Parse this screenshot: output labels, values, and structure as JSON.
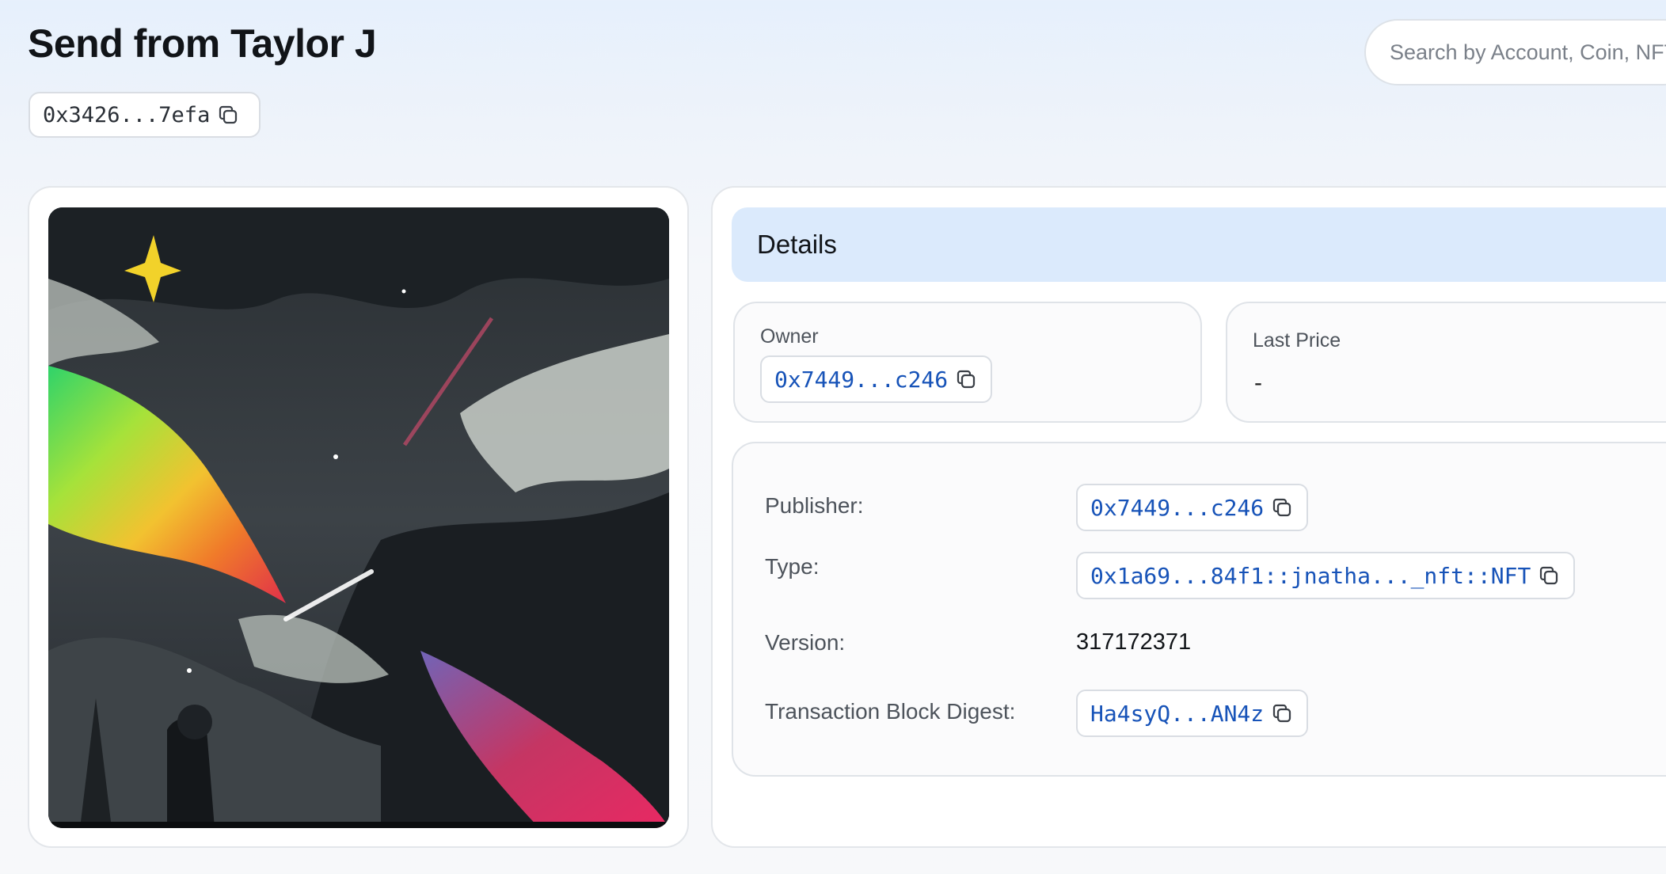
{
  "page": {
    "title": "Send from Taylor J",
    "address_short": "0x3426...7efa"
  },
  "search": {
    "placeholder": "Search by Account, Coin, NFT, Package, Object, Transaction..."
  },
  "details": {
    "header": "Details",
    "owner": {
      "label": "Owner",
      "value": "0x7449...c246"
    },
    "last_price": {
      "label": "Last Price",
      "value": "-"
    },
    "rows": [
      {
        "label": "Publisher:",
        "value": "0x7449...c246"
      },
      {
        "label": "Type:",
        "value": "0x1a69...84f1::jnatha..._nft::NFT"
      },
      {
        "label": "Version:",
        "value": "317172371"
      },
      {
        "label": "Transaction Block Digest:",
        "value": "Ha4syQ...AN4z"
      }
    ]
  },
  "colors": {
    "link": "#1753b8",
    "header_bg": "#dbeafc",
    "page_bg_top": "#e6f0fc"
  },
  "icons": {
    "copy": "copy-icon",
    "nft_image": "nft-artwork-image"
  }
}
